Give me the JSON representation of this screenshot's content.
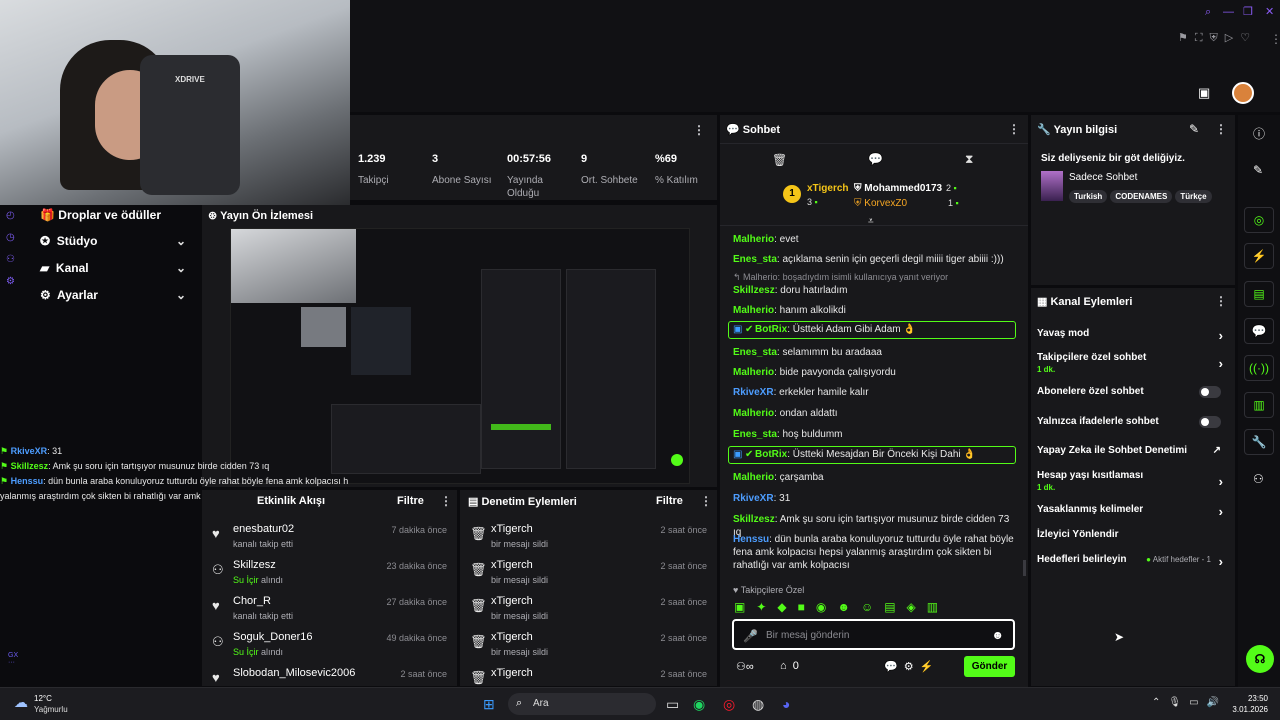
{
  "top_icons": {
    "search": "search-icon",
    "restore": "restore-icon",
    "close": "close-icon"
  },
  "stats": [
    {
      "value": "1.239",
      "label": "Takipçi"
    },
    {
      "value": "3",
      "label": "Abone Sayısı"
    },
    {
      "value": "00:57:56",
      "label": "Yayında Olduğu"
    },
    {
      "value": "9",
      "label": "Ort. Sohbete"
    },
    {
      "value": "%69",
      "label": "% Katılım"
    }
  ],
  "leftnav": {
    "items": [
      "Droplar ve ödüller",
      "Stüdyo",
      "Kanal",
      "Ayarlar"
    ]
  },
  "preview": {
    "title": "Yayın Ön İzlemesi"
  },
  "chat_overlay": [
    {
      "user": "RkiveXR",
      "text": ": 31",
      "color": "#4d9dff"
    },
    {
      "user": "Skillzesz",
      "text": ": Amk şu soru için tartışıyor musunuz birde cidden 73 ıq",
      "color": "#53fc18"
    },
    {
      "user": "Henssu",
      "text": ": dün bunla araba konuluyoruz tutturdu öyle rahat böyle fena amk kolpacısı h",
      "color": "#4d9dff"
    },
    {
      "user": "",
      "text": "yalanmış araştırdım çok sikten bi rahatlığı var amk kolpacısı",
      "color": ""
    }
  ],
  "activity": {
    "title": "Etkinlik Akışı",
    "filter": "Filtre",
    "rows": [
      {
        "name": "enesbatur02",
        "sub": "kanalı takip etti",
        "time": "7 dakika önce",
        "hl": ""
      },
      {
        "name": "Skillzesz",
        "sub": "alındı",
        "hl": "Su İçir",
        "time": "23 dakika önce"
      },
      {
        "name": "Chor_R",
        "sub": "kanalı takip etti",
        "time": "27 dakika önce",
        "hl": ""
      },
      {
        "name": "Soguk_Doner16",
        "sub": "alındı",
        "hl": "Su İçir",
        "time": "49 dakika önce"
      },
      {
        "name": "Slobodan_Milosevic2006",
        "sub": "",
        "time": "2 saat önce",
        "hl": ""
      }
    ]
  },
  "moderation": {
    "title": "Denetim Eylemleri",
    "filter": "Filtre",
    "rows": [
      {
        "name": "xTigerch",
        "sub": "bir mesajı sildi",
        "time": "2 saat önce"
      },
      {
        "name": "xTigerch",
        "sub": "bir mesajı sildi",
        "time": "2 saat önce"
      },
      {
        "name": "xTigerch",
        "sub": "bir mesajı sildi",
        "time": "2 saat önce"
      },
      {
        "name": "xTigerch",
        "sub": "bir mesajı sildi",
        "time": "2 saat önce"
      },
      {
        "name": "xTigerch",
        "sub": "",
        "time": "2 saat önce"
      }
    ]
  },
  "chat": {
    "title": "Sohbet",
    "top": [
      {
        "name": "xTigerch",
        "count": "3",
        "rank": "1"
      },
      {
        "name": "Mohammed0173",
        "count": "2"
      },
      {
        "name": "KorvexZ0",
        "count": "1"
      }
    ],
    "messages": [
      {
        "type": "msg",
        "user": "Malherio",
        "text": ": evet",
        "color": "#53fc18"
      },
      {
        "type": "msg",
        "user": "Enes_sta",
        "text": ": açıklama senin için geçerli degil miiii tiger abiiii :)))",
        "color": "#53fc18"
      },
      {
        "type": "reply",
        "text": "Malherio: boşadıydım isimli kullanıcıya yanıt veriyor"
      },
      {
        "type": "msg",
        "user": "Skillzesz",
        "text": ": doru hatırladım",
        "color": "#53fc18"
      },
      {
        "type": "msg",
        "user": "Malherio",
        "text": ": hanım alkolikdi",
        "color": "#53fc18"
      },
      {
        "type": "bot",
        "user": "BotRix",
        "text": ": Üstteki Adam Gibi Adam 👌"
      },
      {
        "type": "msg",
        "user": "Enes_sta",
        "text": ": selamımm bu aradaaa",
        "color": "#53fc18"
      },
      {
        "type": "msg",
        "user": "Malherio",
        "text": ": bide pavyonda çalışıyordu",
        "color": "#53fc18"
      },
      {
        "type": "msg",
        "user": "RkiveXR",
        "text": ": erkekler hamile kalır",
        "color": "#4d9dff"
      },
      {
        "type": "msg",
        "user": "Malherio",
        "text": ": ondan aldattı",
        "color": "#53fc18"
      },
      {
        "type": "msg",
        "user": "Enes_sta",
        "text": ": hoş buldumm",
        "color": "#53fc18"
      },
      {
        "type": "bot",
        "user": "BotRix",
        "text": ": Üstteki Mesajdan Bir Önceki Kişi Dahi 👌"
      },
      {
        "type": "msg",
        "user": "Malherio",
        "text": ": çarşamba",
        "color": "#53fc18"
      },
      {
        "type": "msg",
        "user": "RkiveXR",
        "text": ": 31",
        "color": "#4d9dff"
      },
      {
        "type": "msg",
        "user": "Skillzesz",
        "text": ": Amk şu soru için tartışıyor musunuz birde cidden 73 ıq",
        "color": "#53fc18"
      },
      {
        "type": "msg",
        "user": "Henssu",
        "text": ": dün bunla araba konuluyoruz tutturdu öyle rahat böyle fena amk kolpacısı hepsi yalanmış araştırdım çok sikten bi rahatlığı var amk kolpacısı",
        "color": "#4d9dff"
      }
    ],
    "emote_label": "Takipçilere Özel",
    "input_placeholder": "Bir mesaj gönderin",
    "points": "0",
    "send": "Gönder"
  },
  "info": {
    "title": "Yayın bilgisi",
    "stream_title": "Siz deliyseniz bir göt deliğiyiz.",
    "category": "Sadece Sohbet",
    "tags": [
      "Turkish",
      "CODENAMES",
      "Türkçe"
    ]
  },
  "actions": {
    "title": "Kanal Eylemleri",
    "items": [
      {
        "label": "Yavaş mod",
        "sub": "",
        "ctrl": "chevron"
      },
      {
        "label": "Takipçilere özel sohbet",
        "sub": "1 dk.",
        "ctrl": "chevron"
      },
      {
        "label": "Abonelere özel sohbet",
        "sub": "",
        "ctrl": "toggle"
      },
      {
        "label": "Yalnızca ifadelerle sohbet",
        "sub": "",
        "ctrl": "toggle"
      },
      {
        "label": "Yapay Zeka ile Sohbet Denetimi",
        "sub": "",
        "ctrl": "external"
      },
      {
        "label": "Hesap yaşı kısıtlaması",
        "sub": "1 dk.",
        "ctrl": "chevron"
      },
      {
        "label": "Yasaklanmış kelimeler",
        "sub": "",
        "ctrl": "chevron"
      },
      {
        "label": "İzleyici Yönlendir",
        "sub": "",
        "ctrl": ""
      },
      {
        "label": "Hedefleri belirleyin",
        "sub": "",
        "ctrl": "chevron",
        "extra": "Aktif hedefler - 1"
      }
    ]
  },
  "taskbar": {
    "weather_temp": "12°C",
    "weather_desc": "Yağmurlu",
    "search": "Ara",
    "time": "23:50",
    "date": "3.01.2026"
  }
}
